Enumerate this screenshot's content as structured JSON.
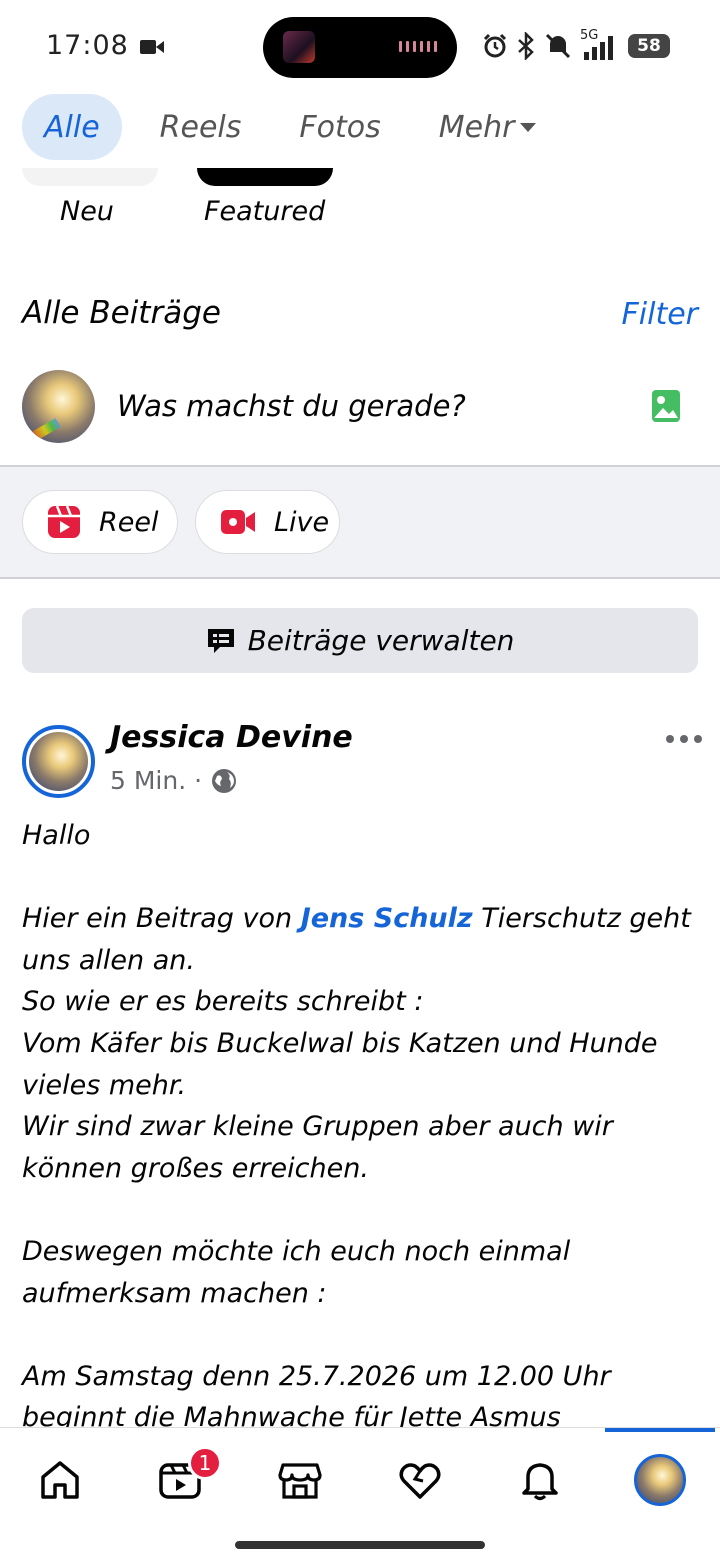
{
  "status_bar": {
    "time": "17:08",
    "network": "5G",
    "battery": "58"
  },
  "tabs": [
    {
      "label": "Alle",
      "active": true
    },
    {
      "label": "Reels",
      "active": false
    },
    {
      "label": "Fotos",
      "active": false
    },
    {
      "label": "Mehr",
      "active": false
    }
  ],
  "highlights": [
    {
      "label": "Neu"
    },
    {
      "label": "Featured"
    }
  ],
  "section": {
    "title": "Alle Beiträge",
    "filter_label": "Filter"
  },
  "composer": {
    "prompt": "Was machst du gerade?"
  },
  "quick_actions": [
    {
      "label": "Reel",
      "icon": "reel-icon"
    },
    {
      "label": "Live",
      "icon": "video-camera-icon"
    }
  ],
  "manage_posts_label": "Beiträge verwalten",
  "post": {
    "author": "Jessica Devine",
    "time": "5 Min. ·",
    "body": {
      "greeting": "Hallo",
      "p1_before": "Hier ein Beitrag von ",
      "p1_mention": "Jens Schulz",
      "p1_after": " Tierschutz geht uns allen an.\nSo wie er es bereits schreibt :\nVom Käfer bis Buckelwal bis Katzen und Hunde vieles mehr.\nWir sind zwar kleine Gruppen aber auch wir können großes erreichen.",
      "p2": "Deswegen möchte ich euch noch einmal aufmerksam machen :",
      "p3": "Am Samstag denn 25.7.2026 um 12.00 Uhr beginnt die Mahnwache für Jette Asmus"
    }
  },
  "bottom_nav": {
    "items": [
      "home-icon",
      "video-icon",
      "marketplace-icon",
      "dating-icon",
      "bell-icon",
      "profile-avatar"
    ],
    "video_badge": "1",
    "active": "profile-avatar"
  },
  "colors": {
    "accent": "#1565d8",
    "badge": "#e41e3f",
    "reel": "#e41e3f",
    "photo": "#45bd62"
  }
}
